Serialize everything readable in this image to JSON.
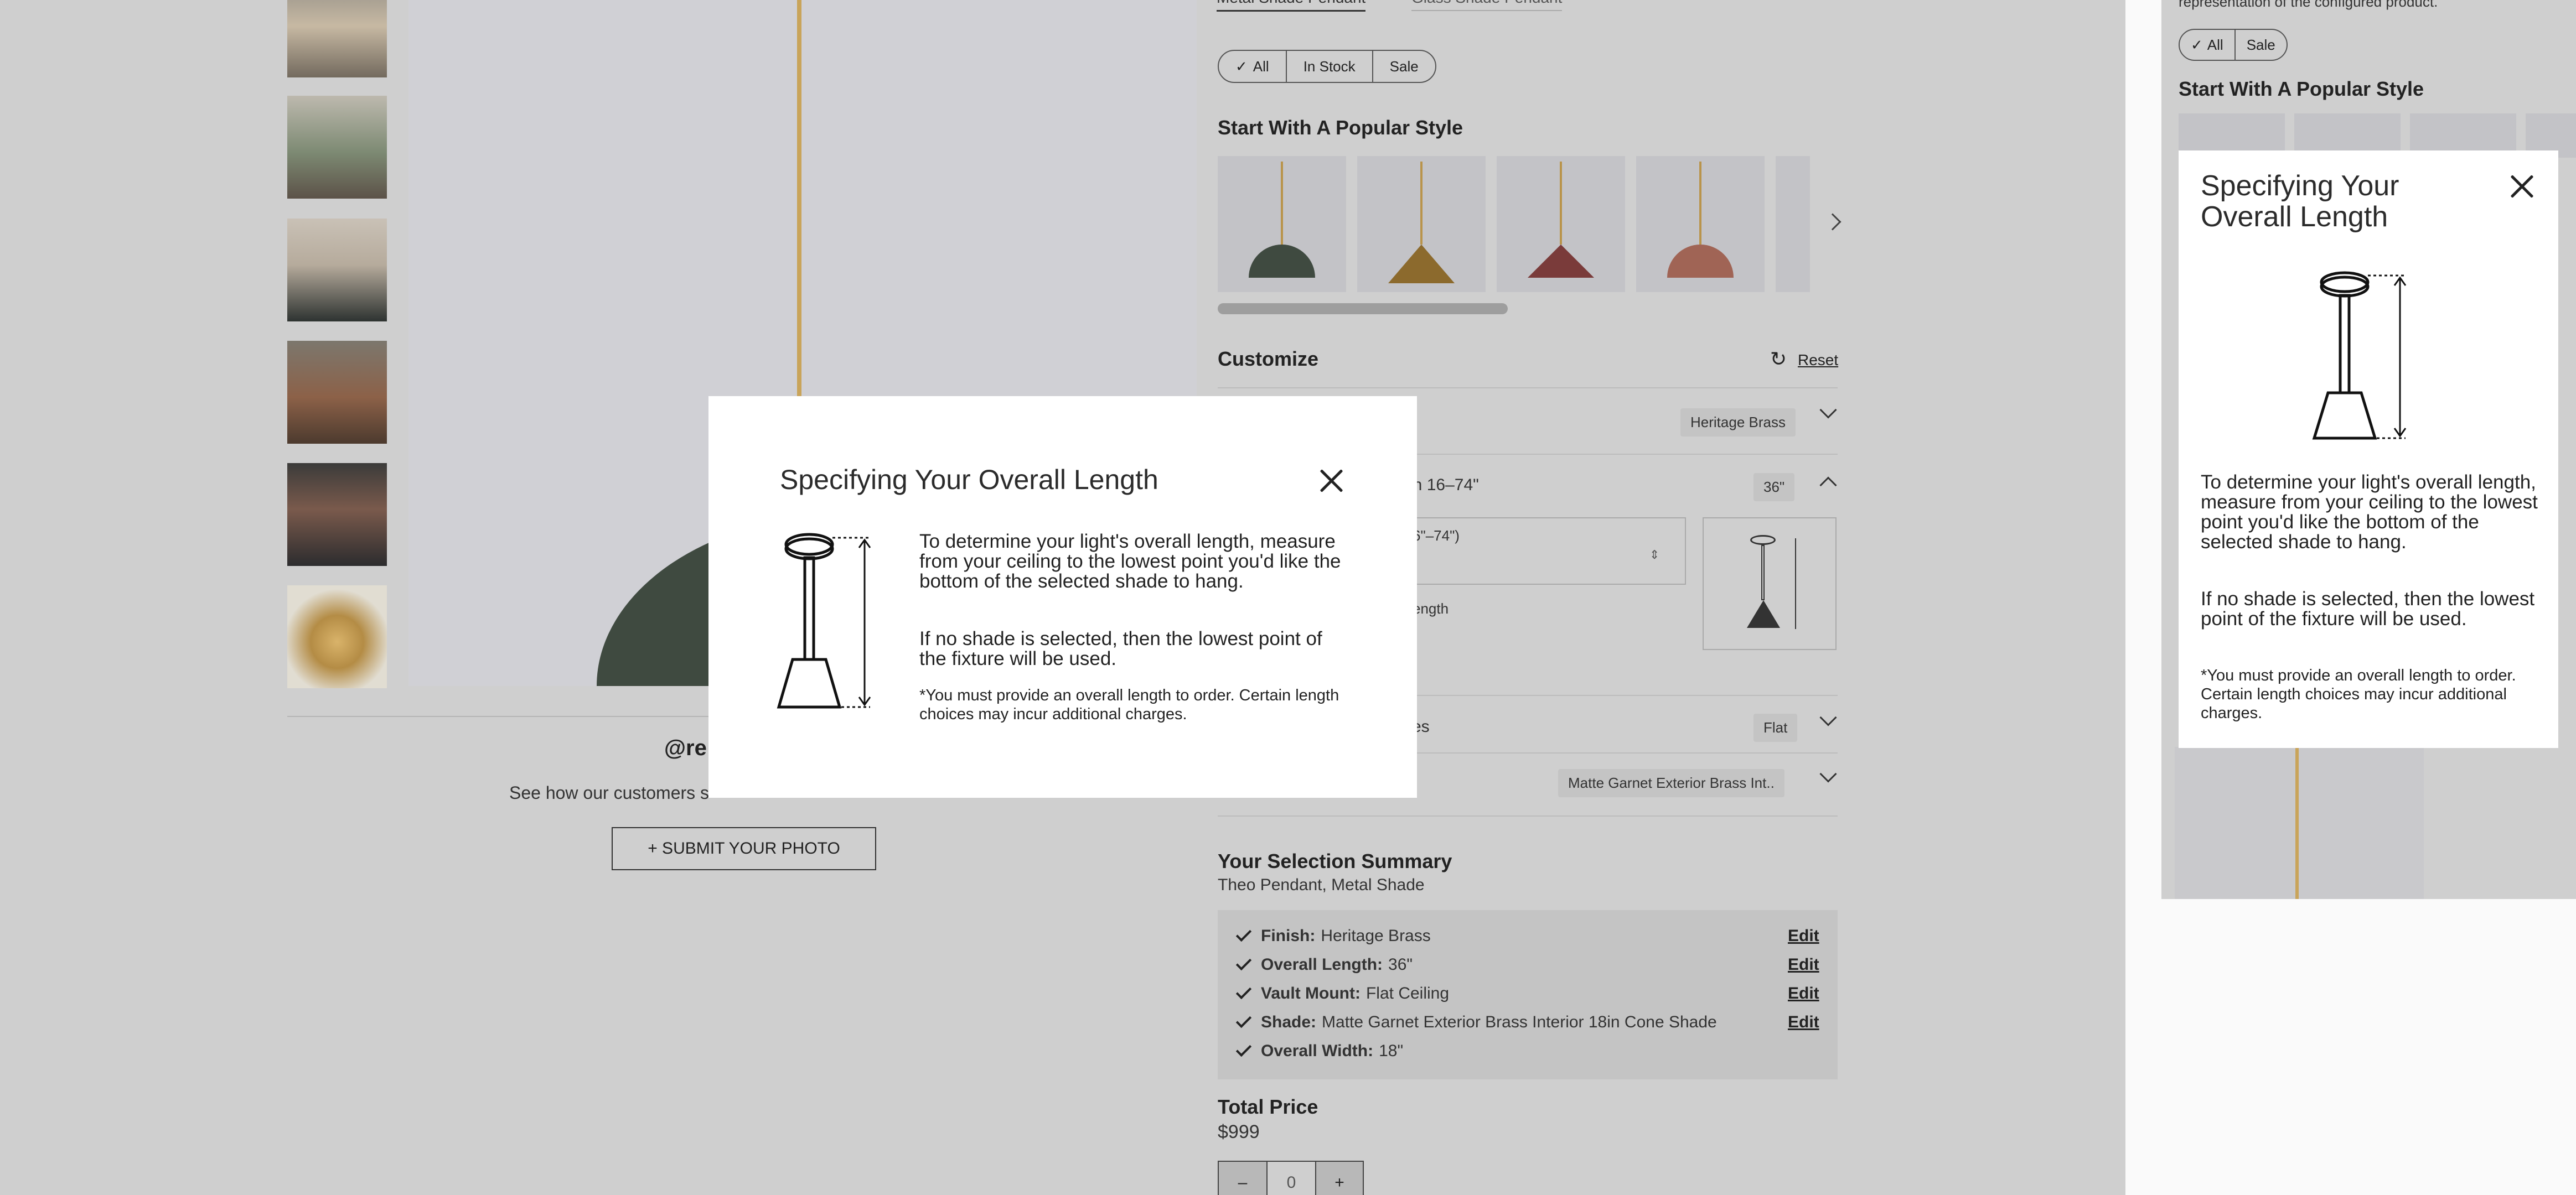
{
  "product_page": {
    "tabs": [
      "Metal Shade Pendant",
      "Glass Shade Pendant"
    ],
    "filters": [
      "All",
      "In Stock",
      "Sale"
    ],
    "popular_style_heading": "Start With A Popular Style",
    "customize": {
      "title": "Customize",
      "reset_label": "Reset",
      "finish_value": "Heritage Brass",
      "length_label_partial": "en 16–74\"",
      "length_value": "36\"",
      "length_input_hint_partial": "6\"–74\")",
      "length_help_partial": "ength",
      "vault_label_partial": "ces",
      "vault_value": "Flat",
      "shade_value": "Matte Garnet Exterior Brass Int.."
    },
    "community": {
      "handle_partial": "@re",
      "tagline_partial": "See how our customers s",
      "submit_label": "+ SUBMIT YOUR PHOTO"
    },
    "summary": {
      "title": "Your Selection Summary",
      "subtitle": "Theo Pendant, Metal Shade",
      "items": [
        {
          "label": "Finish:",
          "value": "Heritage Brass",
          "edit": "Edit"
        },
        {
          "label": "Overall Length:",
          "value": "36\"",
          "edit": "Edit"
        },
        {
          "label": "Vault Mount:",
          "value": "Flat Ceiling",
          "edit": "Edit"
        },
        {
          "label": "Shade:",
          "value": "Matte Garnet Exterior Brass Interior 18in Cone Shade",
          "edit": "Edit"
        },
        {
          "label": "Overall Width:",
          "value": "18\"",
          "edit": ""
        }
      ]
    },
    "total": {
      "label": "Total Price",
      "price": "$999",
      "qty_minus": "–",
      "qty_value": "0",
      "qty_plus": "+"
    }
  },
  "mobile_page": {
    "top_text": "representation of the configured product.",
    "filters": [
      "All",
      "Sale"
    ],
    "popular_style_heading": "Start With A Popular Style"
  },
  "modal": {
    "title": "Specifying Your Overall Length",
    "paragraph1": "To determine your light's overall length, measure from your ceiling to the lowest point you'd like the bottom of the selected shade to hang.",
    "paragraph2": "If no shade is selected, then the lowest point of the fixture will be used.",
    "note": "*You must provide an overall length to order. Certain length choices may incur additional charges."
  },
  "mobile_modal": {
    "title_line1": "Specifying Your",
    "title_line2": "Overall Length"
  }
}
